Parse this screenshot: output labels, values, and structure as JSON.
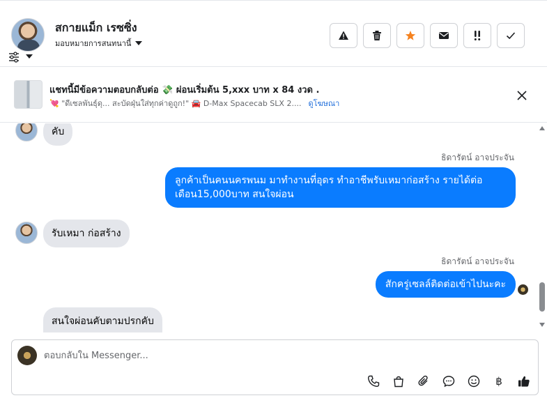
{
  "header": {
    "contact_name": "สกายแม็ก เรซซิ่ง",
    "assign_label": "มอบหมายการสนทนานี้",
    "actions": [
      {
        "name": "report-button",
        "icon": "warning-icon"
      },
      {
        "name": "delete-button",
        "icon": "trash-icon"
      },
      {
        "name": "star-button",
        "icon": "star-icon",
        "color": "#f5821f"
      },
      {
        "name": "mark-unread-button",
        "icon": "envelope-icon"
      },
      {
        "name": "follow-up-button",
        "icon": "exclamation-icon"
      },
      {
        "name": "done-button",
        "icon": "check-icon"
      }
    ]
  },
  "ad": {
    "title": "แชทนี้มีข้อความตอบกลับต่อ 💸 ผ่อนเริ่มต้น 5,xxx บาท x 84 งวด .",
    "subtitle": "💘 \"ดีเซลพันธุ์ดุ... สะบัดฝุ่นใส่ทุกค่าดูถูก!\" 🚘 D-Max Spacecab SLX 2....",
    "link": "ดูโฆษณา"
  },
  "messages": [
    {
      "direction": "in",
      "text": "คับ"
    },
    {
      "direction": "out",
      "sender": "ธิดารัตน์ อาจประจัน",
      "lines": [
        "ลูกค้าเป็นคนนครพนม มาทำงานที่อุดร ทำอาชีพรับเหมาก่อสร้าง รายได้ต่อ",
        "เดือน15,000บาท สนใจผ่อน"
      ]
    },
    {
      "direction": "in",
      "text": "รับเหมา ก่อสร้าง"
    },
    {
      "direction": "out",
      "sender": "ธิดารัตน์ อาจประจัน",
      "lines": [
        "สักครู่เซลล์ติดต่อเข้าไปนะคะ"
      ]
    },
    {
      "direction": "in",
      "text": "สนใจผ่อนคับตามปรกคับ"
    }
  ],
  "composer": {
    "placeholder": "ตอบกลับใน Messenger...",
    "tools": [
      "phone-icon",
      "shopping-bag-icon",
      "paperclip-icon",
      "chat-bubble-icon",
      "emoji-icon",
      "baht-icon",
      "thumbs-up-icon"
    ],
    "baht_symbol": "฿"
  },
  "colors": {
    "accent": "#0a7cff",
    "incoming_bubble": "#e4e6eb",
    "star": "#f5821f"
  }
}
